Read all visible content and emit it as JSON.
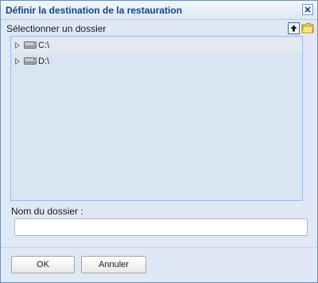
{
  "dialog": {
    "title": "Définir la destination de la restauration",
    "close_icon": "close-icon"
  },
  "browser": {
    "select_label": "Sélectionner un dossier",
    "up_icon": "up-arrow-icon",
    "new_folder_icon": "new-folder-icon",
    "drives": [
      {
        "label": "C:\\",
        "icon": "hard-drive-icon",
        "selected": true
      },
      {
        "label": "D:\\",
        "icon": "hard-drive-icon",
        "selected": false
      }
    ]
  },
  "folder_name": {
    "label": "Nom du dossier :",
    "value": "",
    "placeholder": ""
  },
  "buttons": {
    "ok_label": "OK",
    "cancel_label": "Annuler"
  },
  "colors": {
    "title_text": "#15428b",
    "dialog_background": "#dfe9f5",
    "tree_background": "#d9e5f3",
    "tree_border": "#99bbe8"
  }
}
